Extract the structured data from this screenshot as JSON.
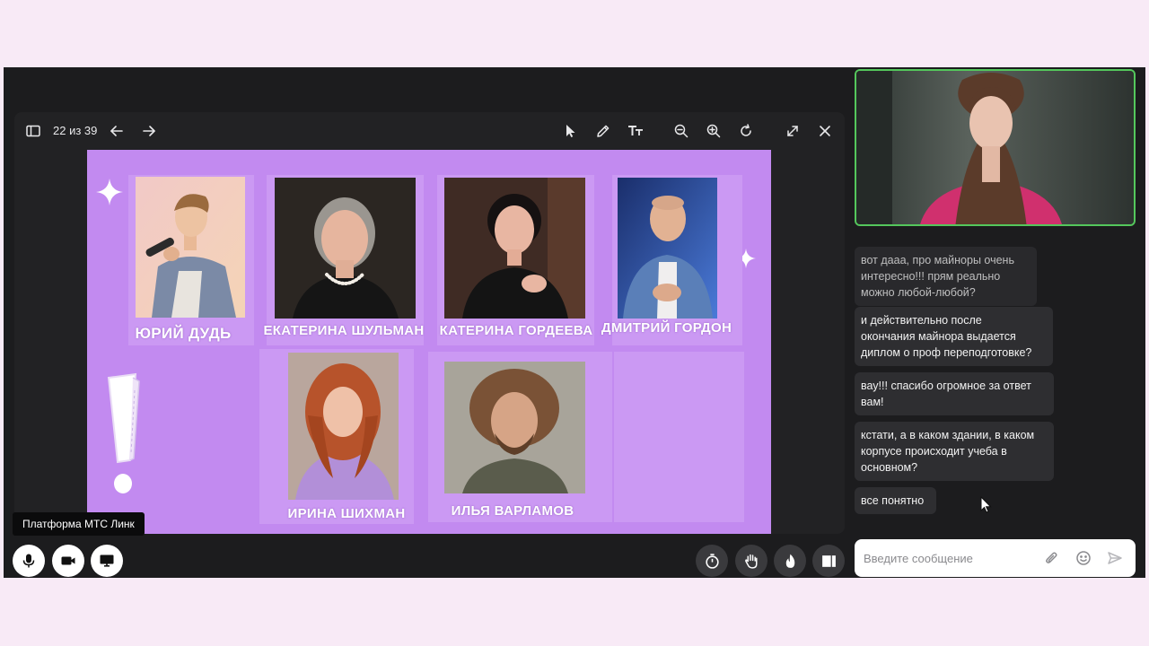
{
  "viewer": {
    "page_counter": "22 из 39",
    "slide": {
      "people": [
        {
          "name": "ЮРИЙ ДУДЬ"
        },
        {
          "name": "ЕКАТЕРИНА ШУЛЬМАН"
        },
        {
          "name": "КАТЕРИНА ГОРДЕЕВА"
        },
        {
          "name": "ДМИТРИЙ ГОРДОН"
        },
        {
          "name": "ИРИНА ШИХМАН"
        },
        {
          "name": "ИЛЬЯ ВАРЛАМОВ"
        }
      ],
      "exclamation": "!"
    }
  },
  "platform_badge": "Платформа МТС Линк",
  "chat": {
    "messages": [
      {
        "lines": [
          "вот дааа, про майноры очень",
          "интересно!!! прям реально",
          "можно любой-любой?"
        ]
      },
      {
        "lines": [
          "и действительно после",
          "окончания майнора выдается",
          "диплом о проф переподготовке?"
        ]
      },
      {
        "lines": [
          "вау!!! спасибо огромное за ответ",
          "вам!"
        ]
      },
      {
        "lines": [
          "кстати, а в каком здании, в каком",
          "корпусе происходит учеба в",
          "основном?"
        ]
      },
      {
        "lines": [
          "все понятно"
        ]
      }
    ],
    "input_placeholder": "Введите сообщение"
  },
  "colors": {
    "background": "#f8eaf6",
    "app": "#1c1c1e",
    "slide": "#c28af0",
    "speaking_border": "#54c75c"
  }
}
